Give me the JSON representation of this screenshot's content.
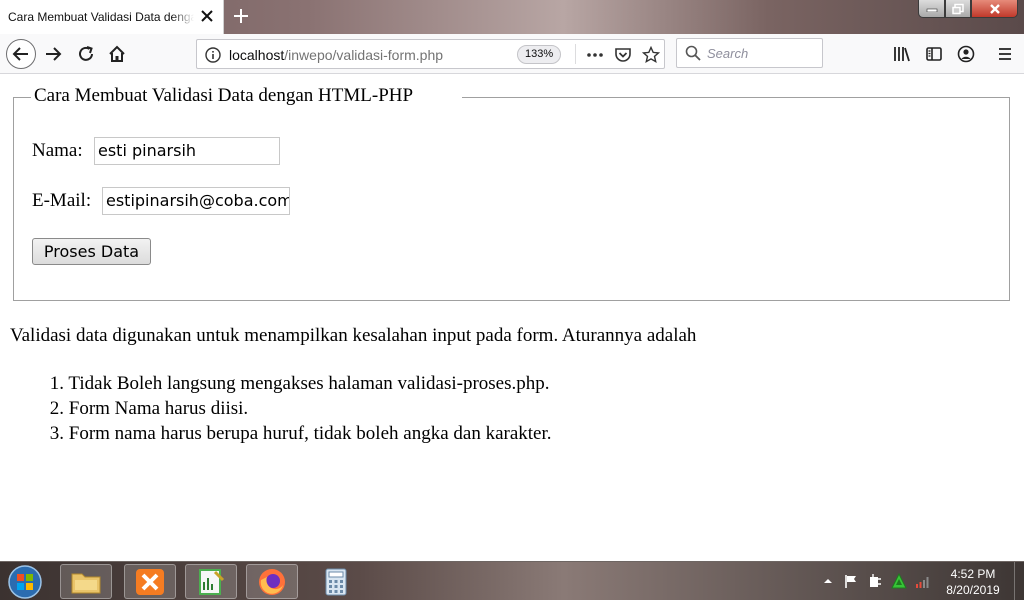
{
  "browser": {
    "tab_title": "Cara Membuat Validasi Data dengan HTML-PHP",
    "url_host": "localhost",
    "url_path": "/inwepo/validasi-form.php",
    "zoom": "133%",
    "search_placeholder": "Search"
  },
  "page": {
    "legend": "Cara Membuat Validasi Data dengan HTML-PHP",
    "name_label": "Nama:",
    "name_value": "esti pinarsih",
    "email_label": "E-Mail:",
    "email_value": "estipinarsih@coba.com",
    "submit_label": "Proses Data",
    "intro": "Validasi data digunakan untuk menampilkan kesalahan input pada form. Aturannya adalah",
    "rules": [
      {
        "num": "1.",
        "text": "Tidak Boleh langsung mengakses halaman validasi-proses.php."
      },
      {
        "num": "2.",
        "text": "Form Nama harus diisi."
      },
      {
        "num": "3.",
        "text": "Form nama harus berupa huruf, tidak boleh angka dan karakter."
      }
    ]
  },
  "taskbar": {
    "time": "4:52 PM",
    "date": "8/20/2019"
  },
  "colors": {
    "close_red": "#c0392b",
    "firefox_orange": "#ff7139"
  }
}
